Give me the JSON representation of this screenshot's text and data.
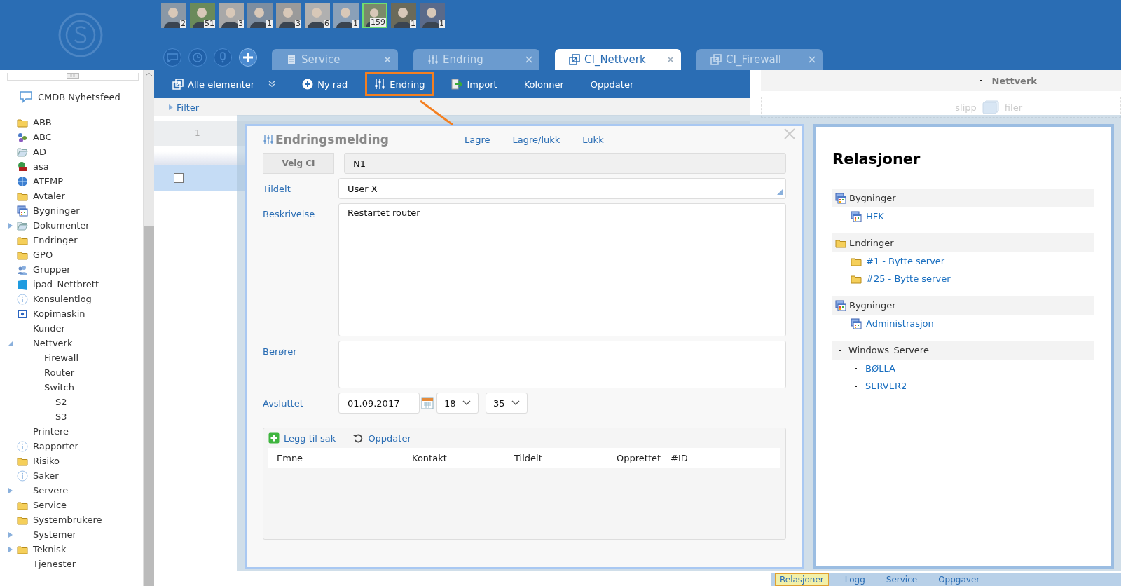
{
  "header": {
    "avatars": [
      {
        "count": "2",
        "selected": false
      },
      {
        "count": "51",
        "selected": false
      },
      {
        "count": "3",
        "selected": false
      },
      {
        "count": "1",
        "selected": false
      },
      {
        "count": "3",
        "selected": false
      },
      {
        "count": "6",
        "selected": false
      },
      {
        "count": "1",
        "selected": false
      },
      {
        "count": "159",
        "selected": true
      },
      {
        "count": "1",
        "selected": false
      },
      {
        "count": "1",
        "selected": false
      }
    ],
    "tabs": [
      {
        "label": "Service",
        "kind": "doc",
        "selected": false
      },
      {
        "label": "Endring",
        "kind": "sliders",
        "selected": false
      },
      {
        "label": "CI_Nettverk",
        "kind": "copy",
        "selected": true
      },
      {
        "label": "CI_Firewall",
        "kind": "copy",
        "selected": false
      }
    ]
  },
  "sidebar": {
    "feed": "CMDB Nyhetsfeed",
    "items": [
      {
        "label": "ABB",
        "kind": "folder"
      },
      {
        "label": "ABC",
        "kind": "people"
      },
      {
        "label": "AD",
        "kind": "open-folder"
      },
      {
        "label": "asa",
        "kind": "globe-card"
      },
      {
        "label": "ATEMP",
        "kind": "globe"
      },
      {
        "label": "Avtaler",
        "kind": "folder"
      },
      {
        "label": "Bygninger",
        "kind": "grid"
      },
      {
        "label": "Dokumenter",
        "kind": "open-folder",
        "expanded": false
      },
      {
        "label": "Endringer",
        "kind": "folder"
      },
      {
        "label": "GPO",
        "kind": "folder"
      },
      {
        "label": "Grupper",
        "kind": "group"
      },
      {
        "label": "ipad_Nettbrett",
        "kind": "windows"
      },
      {
        "label": "Konsulentlog",
        "kind": "info"
      },
      {
        "label": "Kopimaskin",
        "kind": "screen"
      },
      {
        "label": "Kunder",
        "kind": "none"
      },
      {
        "label": "Nettverk",
        "kind": "none",
        "expanded": true,
        "children": [
          {
            "label": "Firewall",
            "kind": "none"
          },
          {
            "label": "Router",
            "kind": "none"
          },
          {
            "label": "Switch",
            "kind": "none",
            "children": [
              {
                "label": "S2",
                "kind": "none"
              },
              {
                "label": "S3",
                "kind": "none"
              }
            ]
          }
        ]
      },
      {
        "label": "Printere",
        "kind": "none"
      },
      {
        "label": "Rapporter",
        "kind": "info"
      },
      {
        "label": "Risiko",
        "kind": "folder"
      },
      {
        "label": "Saker",
        "kind": "info"
      },
      {
        "label": "Servere",
        "kind": "none",
        "expanded": false
      },
      {
        "label": "Service",
        "kind": "folder"
      },
      {
        "label": "Systembrukere",
        "kind": "folder"
      },
      {
        "label": "Systemer",
        "kind": "none",
        "expanded": false
      },
      {
        "label": "Teknisk",
        "kind": "folder",
        "expanded": false
      },
      {
        "label": "Tjenester",
        "kind": "none"
      }
    ]
  },
  "toolbar": {
    "items": [
      {
        "label": "Alle elementer",
        "kind": "copy",
        "highlighted": false
      },
      {
        "label": "Ny rad",
        "kind": "add-circle",
        "highlighted": false
      },
      {
        "label": "Endring",
        "kind": "sliders",
        "highlighted": true
      },
      {
        "label": "Import",
        "kind": "import",
        "highlighted": false
      },
      {
        "label": "Kolonner",
        "kind": "none",
        "highlighted": false
      },
      {
        "label": "Oppdater",
        "kind": "none",
        "highlighted": false
      }
    ]
  },
  "filter": "Filter",
  "grid": {
    "row_number": "1",
    "rows": [
      {
        "selected": true,
        "checked": false
      }
    ]
  },
  "right_header": {
    "title": "Nettverk"
  },
  "dropzone": {
    "before": "slipp",
    "after": "filer"
  },
  "dialog": {
    "title": "Endringsmelding",
    "actions": [
      "Lagre",
      "Lagre/lukk",
      "Lukk"
    ],
    "ci_button": "Velg CI",
    "ci_value": "N1",
    "fields": [
      {
        "label": "Tildelt",
        "kind": "select",
        "value": "User X"
      },
      {
        "label": "Beskrivelse",
        "kind": "textarea",
        "value": "Restartet router"
      },
      {
        "label": "Berører",
        "kind": "textarea-small"
      },
      {
        "label": "Avsluttet",
        "kind": "datetime",
        "date": "01.09.2017",
        "hour": "18",
        "minute": "35"
      }
    ],
    "cases": {
      "actions": [
        {
          "label": "Legg til sak",
          "kind": "add"
        },
        {
          "label": "Oppdater",
          "kind": "refresh"
        }
      ],
      "columns": [
        "Emne",
        "Kontakt",
        "Tildelt",
        "Opprettet",
        "#ID"
      ]
    }
  },
  "relations": {
    "title": "Relasjoner",
    "groups": [
      {
        "label": "Bygninger",
        "kind": "grid",
        "items": [
          {
            "label": "HFK",
            "kind": "grid"
          }
        ]
      },
      {
        "label": "Endringer",
        "kind": "folder",
        "items": [
          {
            "label": "#1 - Bytte server",
            "kind": "folder"
          },
          {
            "label": "#25 - Bytte server",
            "kind": "folder"
          }
        ]
      },
      {
        "label": "Bygninger",
        "kind": "grid",
        "items": [
          {
            "label": "Administrasjon",
            "kind": "grid"
          }
        ]
      },
      {
        "label": "Windows_Servere",
        "kind": "bullet",
        "items": [
          {
            "label": "BØLLA",
            "kind": "bullet"
          },
          {
            "label": "SERVER2",
            "kind": "bullet"
          }
        ]
      }
    ]
  },
  "bottom_tabs": [
    {
      "label": "Relasjoner",
      "selected": true
    },
    {
      "label": "Logg",
      "selected": false
    },
    {
      "label": "Service",
      "selected": false
    },
    {
      "label": "Oppgaver",
      "selected": false
    }
  ]
}
